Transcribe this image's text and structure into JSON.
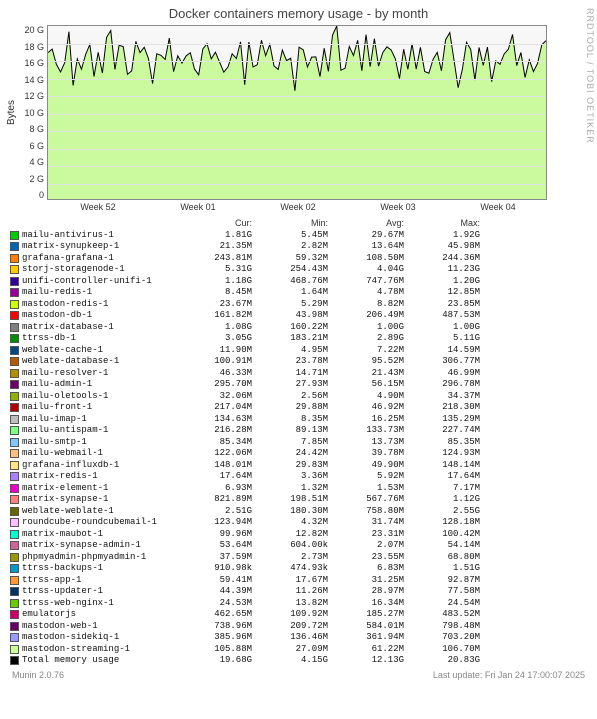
{
  "chart_data": {
    "type": "area",
    "title": "Docker containers memory usage - by month",
    "ylabel": "Bytes",
    "xlabel": "",
    "ylim": [
      0,
      20
    ],
    "yunit": "G",
    "yticks": [
      "20 G",
      "18 G",
      "16 G",
      "14 G",
      "12 G",
      "10 G",
      "8 G",
      "6 G",
      "4 G",
      "2 G",
      "0"
    ],
    "categories": [
      "Week 52",
      "Week 01",
      "Week 02",
      "Week 03",
      "Week 04"
    ],
    "series": [
      {
        "name": "mailu-antivirus-1",
        "color": "#00cc00",
        "cur": "1.81G",
        "min": "5.45M",
        "avg": "29.67M",
        "max": "1.92G"
      },
      {
        "name": "matrix-synupkeep-1",
        "color": "#0066b3",
        "cur": "21.35M",
        "min": "2.82M",
        "avg": "13.64M",
        "max": "45.98M"
      },
      {
        "name": "grafana-grafana-1",
        "color": "#ff8000",
        "cur": "243.81M",
        "min": "59.32M",
        "avg": "108.50M",
        "max": "244.36M"
      },
      {
        "name": "storj-storagenode-1",
        "color": "#ffcc00",
        "cur": "5.31G",
        "min": "254.43M",
        "avg": "4.04G",
        "max": "11.23G"
      },
      {
        "name": "unifi-controller-unifi-1",
        "color": "#330099",
        "cur": "1.18G",
        "min": "468.76M",
        "avg": "747.76M",
        "max": "1.20G"
      },
      {
        "name": "mailu-redis-1",
        "color": "#990099",
        "cur": "8.45M",
        "min": "1.64M",
        "avg": "4.78M",
        "max": "12.85M"
      },
      {
        "name": "mastodon-redis-1",
        "color": "#ccff00",
        "cur": "23.67M",
        "min": "5.29M",
        "avg": "8.82M",
        "max": "23.85M"
      },
      {
        "name": "mastodon-db-1",
        "color": "#ff0000",
        "cur": "161.82M",
        "min": "43.98M",
        "avg": "206.49M",
        "max": "487.53M"
      },
      {
        "name": "matrix-database-1",
        "color": "#808080",
        "cur": "1.08G",
        "min": "160.22M",
        "avg": "1.00G",
        "max": "1.00G"
      },
      {
        "name": "ttrss-db-1",
        "color": "#008f00",
        "cur": "3.05G",
        "min": "183.21M",
        "avg": "2.89G",
        "max": "5.11G"
      },
      {
        "name": "weblate-cache-1",
        "color": "#00487d",
        "cur": "11.90M",
        "min": "4.95M",
        "avg": "7.22M",
        "max": "14.59M"
      },
      {
        "name": "weblate-database-1",
        "color": "#b35a00",
        "cur": "100.91M",
        "min": "23.78M",
        "avg": "95.52M",
        "max": "306.77M"
      },
      {
        "name": "mailu-resolver-1",
        "color": "#b38f00",
        "cur": "46.33M",
        "min": "14.71M",
        "avg": "21.43M",
        "max": "46.99M"
      },
      {
        "name": "mailu-admin-1",
        "color": "#6b006b",
        "cur": "295.70M",
        "min": "27.93M",
        "avg": "56.15M",
        "max": "296.78M"
      },
      {
        "name": "mailu-oletools-1",
        "color": "#8fb300",
        "cur": "32.06M",
        "min": "2.56M",
        "avg": "4.90M",
        "max": "34.37M"
      },
      {
        "name": "mailu-front-1",
        "color": "#b30000",
        "cur": "217.04M",
        "min": "29.88M",
        "avg": "46.92M",
        "max": "218.30M"
      },
      {
        "name": "mailu-imap-1",
        "color": "#bebebe",
        "cur": "134.63M",
        "min": "8.35M",
        "avg": "16.25M",
        "max": "135.29M"
      },
      {
        "name": "mailu-antispam-1",
        "color": "#80ff80",
        "cur": "216.28M",
        "min": "89.13M",
        "avg": "133.73M",
        "max": "227.74M"
      },
      {
        "name": "mailu-smtp-1",
        "color": "#80c9ff",
        "cur": "85.34M",
        "min": "7.85M",
        "avg": "13.73M",
        "max": "85.35M"
      },
      {
        "name": "mailu-webmail-1",
        "color": "#ffc080",
        "cur": "122.06M",
        "min": "24.42M",
        "avg": "39.78M",
        "max": "124.93M"
      },
      {
        "name": "grafana-influxdb-1",
        "color": "#ffe680",
        "cur": "148.01M",
        "min": "29.83M",
        "avg": "49.90M",
        "max": "148.14M"
      },
      {
        "name": "matrix-redis-1",
        "color": "#aa80ff",
        "cur": "17.64M",
        "min": "3.36M",
        "avg": "5.92M",
        "max": "17.64M"
      },
      {
        "name": "matrix-element-1",
        "color": "#ee00cc",
        "cur": "6.93M",
        "min": "1.32M",
        "avg": "1.53M",
        "max": "7.17M"
      },
      {
        "name": "matrix-synapse-1",
        "color": "#ff8080",
        "cur": "821.89M",
        "min": "198.51M",
        "avg": "567.76M",
        "max": "1.12G"
      },
      {
        "name": "weblate-weblate-1",
        "color": "#666600",
        "cur": "2.51G",
        "min": "180.30M",
        "avg": "758.80M",
        "max": "2.55G"
      },
      {
        "name": "roundcube-roundcubemail-1",
        "color": "#ffbfff",
        "cur": "123.94M",
        "min": "4.32M",
        "avg": "31.74M",
        "max": "128.18M"
      },
      {
        "name": "matrix-maubot-1",
        "color": "#00ffcc",
        "cur": "99.96M",
        "min": "12.82M",
        "avg": "23.31M",
        "max": "100.42M"
      },
      {
        "name": "matrix-synapse-admin-1",
        "color": "#cc6699",
        "cur": "53.64M",
        "min": "604.00k",
        "avg": "2.07M",
        "max": "54.14M"
      },
      {
        "name": "phpmyadmin-phpmyadmin-1",
        "color": "#999900",
        "cur": "37.59M",
        "min": "2.73M",
        "avg": "23.55M",
        "max": "68.80M"
      },
      {
        "name": "ttrss-backups-1",
        "color": "#0099cc",
        "cur": "910.98k",
        "min": "474.93k",
        "avg": "6.83M",
        "max": "1.51G"
      },
      {
        "name": "ttrss-app-1",
        "color": "#ff9933",
        "cur": "59.41M",
        "min": "17.67M",
        "avg": "31.25M",
        "max": "92.87M"
      },
      {
        "name": "ttrss-updater-1",
        "color": "#003366",
        "cur": "44.39M",
        "min": "11.26M",
        "avg": "28.97M",
        "max": "77.58M"
      },
      {
        "name": "ttrss-web-nginx-1",
        "color": "#66cc00",
        "cur": "24.53M",
        "min": "13.82M",
        "avg": "16.34M",
        "max": "24.54M"
      },
      {
        "name": "emulatorjs",
        "color": "#cc0066",
        "cur": "462.65M",
        "min": "109.92M",
        "avg": "185.27M",
        "max": "483.52M"
      },
      {
        "name": "mastodon-web-1",
        "color": "#660066",
        "cur": "738.96M",
        "min": "209.72M",
        "avg": "584.01M",
        "max": "798.48M"
      },
      {
        "name": "mastodon-sidekiq-1",
        "color": "#9999ff",
        "cur": "385.96M",
        "min": "136.46M",
        "avg": "361.94M",
        "max": "703.20M"
      },
      {
        "name": "mastodon-streaming-1",
        "color": "#ccff99",
        "cur": "105.88M",
        "min": "27.09M",
        "avg": "61.22M",
        "max": "106.70M"
      },
      {
        "name": "Total memory usage",
        "color": "#000000",
        "cur": "19.68G",
        "min": "4.15G",
        "avg": "12.13G",
        "max": "20.83G"
      }
    ]
  },
  "header": {
    "vtitle": "RRDTOOL / TOBI OETIKER"
  },
  "columns": {
    "name": "",
    "cur": "Cur:",
    "min": "Min:",
    "avg": "Avg:",
    "max": "Max:"
  },
  "footer": {
    "version": "Munin 2.0.76",
    "updated": "Last update: Fri Jan 24 17:00:07 2025"
  }
}
